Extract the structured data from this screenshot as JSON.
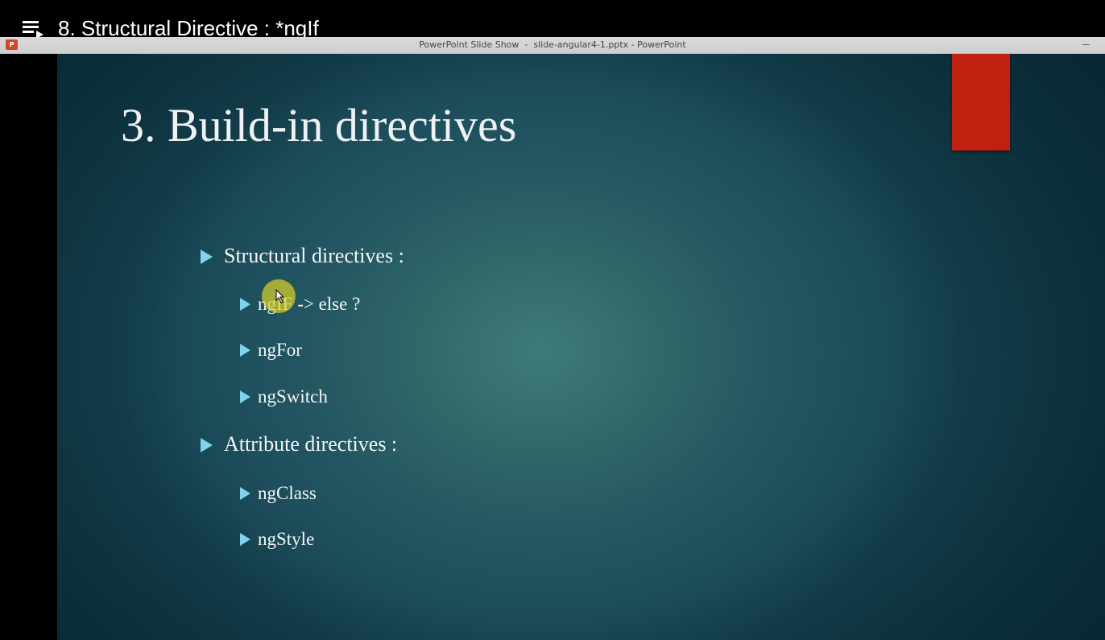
{
  "video": {
    "title": "8. Structural Directive : *ngIf",
    "playlist_icon": "playlist-icon"
  },
  "window": {
    "title": "PowerPoint Slide Show  -  slide-angular4-1.pptx - PowerPoint",
    "app_icon": "powerpoint-app-icon",
    "app_icon_text": "P"
  },
  "slide": {
    "title": "3. Build-in directives",
    "accent_color": "#c0200f",
    "bullet_color": "#7fd3ee",
    "sections": [
      {
        "label": "Structural directives :",
        "items": [
          "ngIF -> else ?",
          "ngFor",
          "ngSwitch"
        ]
      },
      {
        "label": "Attribute directives :",
        "items": [
          "ngClass",
          "ngStyle"
        ]
      }
    ]
  },
  "cursor": {
    "highlight_color": "#d6d028"
  }
}
